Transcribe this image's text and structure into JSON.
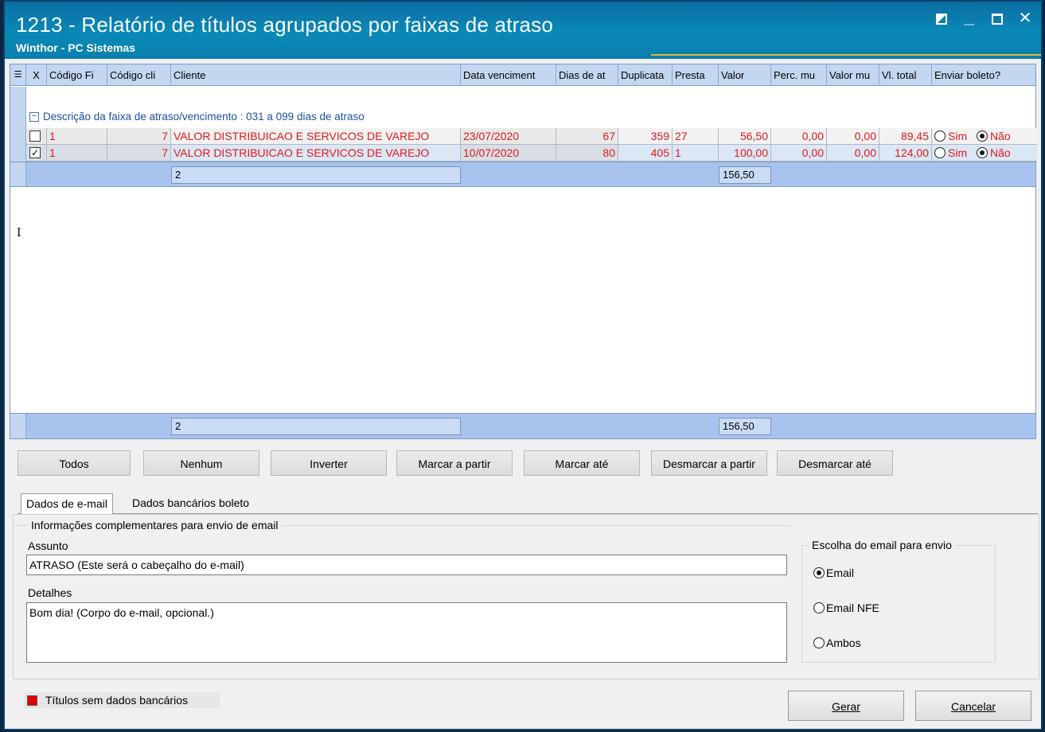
{
  "window": {
    "title": "1213 - Relatório de títulos agrupados por faixas de atraso",
    "subtitle": "Winthor - PC Sistemas"
  },
  "grid": {
    "columns": [
      "X",
      "Código Fi",
      "Código cli",
      "Cliente",
      "Data venciment",
      "Dias de at",
      "Duplicata",
      "Presta",
      "Valor",
      "Perc. mu",
      "Valor mu",
      "Vl. total",
      "Enviar boleto?"
    ],
    "group_label": "Descrição da faixa de atraso/vencimento : 031 a  099 dias de atraso",
    "rows": [
      {
        "checked": false,
        "cod_filial": "1",
        "cod_cliente": "7",
        "cliente": "VALOR DISTRIBUICAO E SERVICOS DE VAREJO",
        "data_venc": "23/07/2020",
        "dias_atraso": "67",
        "duplicata": "359",
        "prestacao": "27",
        "valor": "56,50",
        "perc_multa": "0,00",
        "valor_multa": "0,00",
        "vl_total": "89,45",
        "boleto_sim": "Sim",
        "boleto_nao": "Não",
        "boleto_selected": "Não"
      },
      {
        "checked": true,
        "cod_filial": "1",
        "cod_cliente": "7",
        "cliente": "VALOR DISTRIBUICAO E SERVICOS DE VAREJO",
        "data_venc": "10/07/2020",
        "dias_atraso": "80",
        "duplicata": "405",
        "prestacao": "1",
        "valor": "100,00",
        "perc_multa": "0,00",
        "valor_multa": "0,00",
        "vl_total": "124,00",
        "boleto_sim": "Sim",
        "boleto_nao": "Não",
        "boleto_selected": "Não"
      }
    ],
    "group_count": "2",
    "group_total": "156,50",
    "footer_count": "2",
    "footer_total": "156,50"
  },
  "buttons": {
    "todos": "Todos",
    "nenhum": "Nenhum",
    "inverter": "Inverter",
    "marcar_partir": "Marcar a partir",
    "marcar_ate": "Marcar até",
    "desmarcar_partir": "Desmarcar a partir",
    "desmarcar_ate": "Desmarcar até"
  },
  "tabs": {
    "email": "Dados de e-mail",
    "bancarios": "Dados bancários boleto"
  },
  "email_form": {
    "group_title": "Informações complementares para envio de email",
    "assunto_label": "Assunto",
    "assunto_value": "ATRASO (Este será o cabeçalho do e-mail)",
    "detalhes_label": "Detalhes",
    "detalhes_value": "Bom dia! (Corpo do e-mail, opcional.)",
    "choice_title": "Escolha do email para envio",
    "options": [
      "Email",
      "Email NFE",
      "Ambos"
    ],
    "selected": "Email"
  },
  "legend": {
    "text": "Títulos sem dados bancários",
    "color": "#e00000"
  },
  "actions": {
    "gerar": "Gerar",
    "cancelar": "Cancelar"
  },
  "colors": {
    "titlebar": "#0a89b7",
    "row_text": "#e21a1a",
    "group_text": "#1f4ea3",
    "subtotal_band": "#a8c4ee"
  }
}
